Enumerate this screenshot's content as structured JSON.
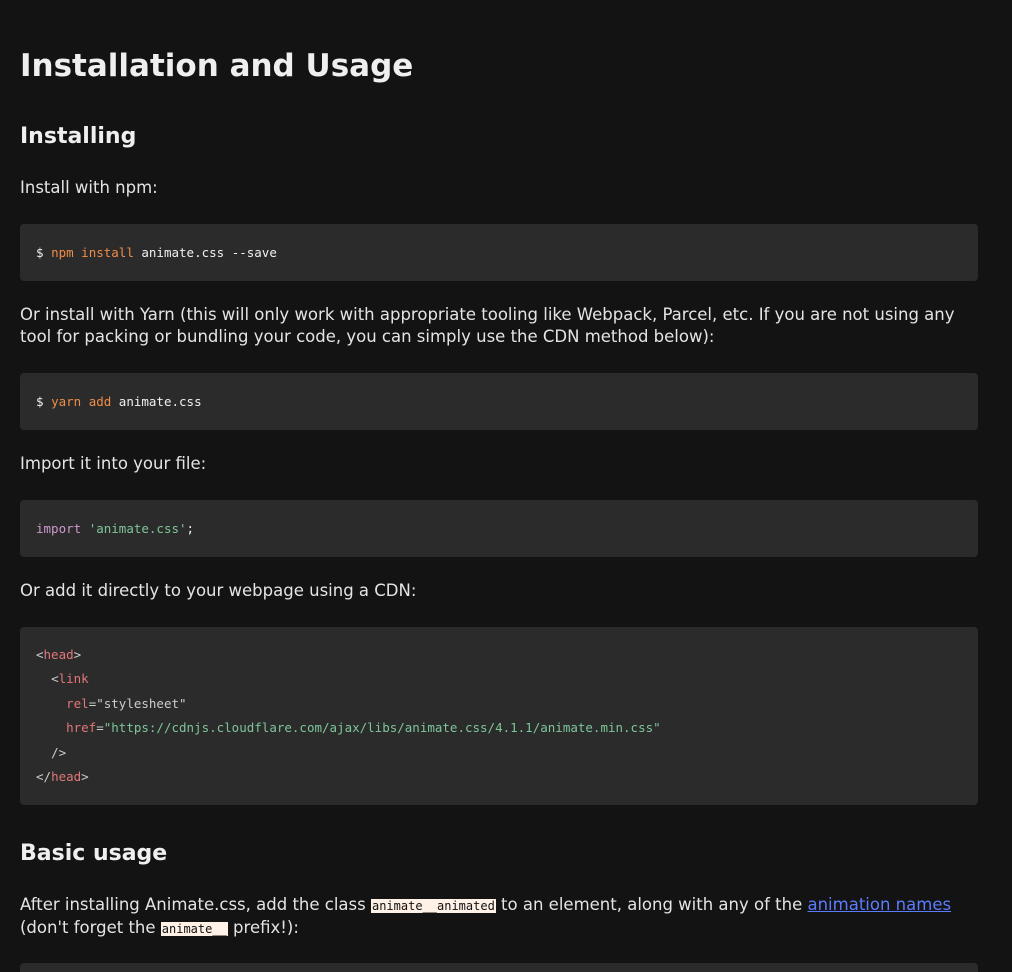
{
  "page": {
    "title": "Installation and Usage",
    "sections": {
      "installing": {
        "heading": "Installing",
        "npm_intro": "Install with npm:",
        "npm_code": {
          "prompt": "$ ",
          "command": "npm install",
          "args": " animate.css --save"
        },
        "yarn_intro": "Or install with Yarn (this will only work with appropriate tooling like Webpack, Parcel, etc. If you are not using any tool for packing or bundling your code, you can simply use the CDN method below):",
        "yarn_code": {
          "prompt": "$ ",
          "command": "yarn add",
          "args": " animate.css"
        },
        "import_intro": "Import it into your file:",
        "import_code": {
          "keyword": "import",
          "space": " ",
          "string": "'animate.css'",
          "end": ";"
        },
        "cdn_intro": "Or add it directly to your webpage using a CDN:",
        "cdn_code": {
          "head_open_lt": "<",
          "head_tag": "head",
          "head_open_gt": ">",
          "link_indent": "  ",
          "link_lt": "<",
          "link_tag": "link",
          "rel_indent": "    ",
          "rel_attr": "rel",
          "rel_eq": "=",
          "rel_value": "\"stylesheet\"",
          "href_indent": "    ",
          "href_attr": "href",
          "href_eq": "=",
          "href_value": "\"https://cdnjs.cloudflare.com/ajax/libs/animate.css/4.1.1/animate.min.css\"",
          "close_indent": "  ",
          "close_selfclose": "/>",
          "head_close_lt": "</",
          "head_close_tag": "head",
          "head_close_gt": ">"
        }
      },
      "basic_usage": {
        "heading": "Basic usage",
        "text_1": "After installing Animate.css, add the class ",
        "class_code": "animate__animated",
        "text_2": " to an element, along with any of the ",
        "link_text": "animation names",
        "text_3": " (don't forget the ",
        "prefix_code": "animate__",
        "text_4": " prefix!):"
      }
    }
  },
  "colors": {
    "background": "#131313",
    "code_background": "#2b2b2b",
    "text": "#e4e4e4",
    "link": "#5b7cff",
    "inline_code_background": "#fff1e6",
    "token_function": "#f08d49",
    "token_keyword": "#cc99cd",
    "token_string": "#7ec699",
    "token_tag": "#e2777a"
  }
}
